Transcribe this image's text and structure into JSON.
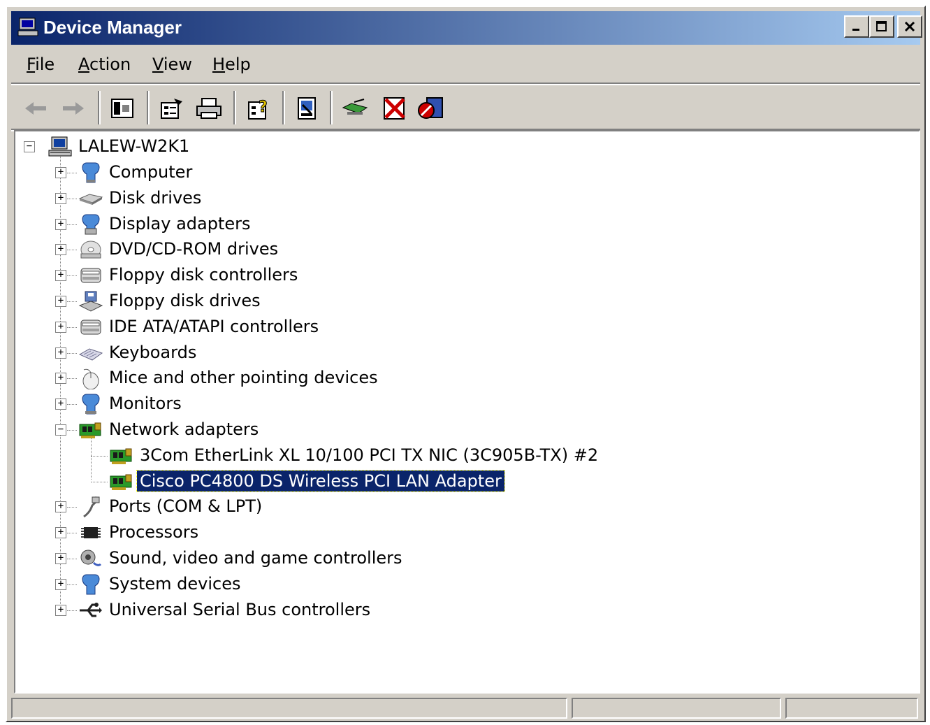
{
  "window": {
    "title": "Device Manager",
    "icon": "computer-icon",
    "controls": [
      "_",
      "□",
      "✕"
    ]
  },
  "menu": [
    {
      "label_first": "F",
      "label_rest": "ile"
    },
    {
      "label_first": "A",
      "label_rest": "ction"
    },
    {
      "label_first": "V",
      "label_rest": "iew"
    },
    {
      "label_first": "H",
      "label_rest": "elp"
    }
  ],
  "toolbar": [
    "back-icon",
    "forward-icon",
    "show-hide-tree-icon",
    "properties-icon",
    "print-icon",
    "help-icon",
    "scan-hardware-icon",
    "update-driver-icon",
    "uninstall-icon",
    "disable-icon"
  ],
  "tree": {
    "root": "LALEW-W2K1",
    "items": [
      {
        "label": "Computer",
        "icon": "computer-blue-icon",
        "expander": "+"
      },
      {
        "label": "Disk drives",
        "icon": "disk-drive-icon",
        "expander": "+"
      },
      {
        "label": "Display adapters",
        "icon": "display-adapter-icon",
        "expander": "+"
      },
      {
        "label": "DVD/CD-ROM drives",
        "icon": "cdrom-icon",
        "expander": "+"
      },
      {
        "label": "Floppy disk controllers",
        "icon": "controller-icon",
        "expander": "+"
      },
      {
        "label": "Floppy disk drives",
        "icon": "floppy-drive-icon",
        "expander": "+"
      },
      {
        "label": "IDE ATA/ATAPI controllers",
        "icon": "controller-icon",
        "expander": "+"
      },
      {
        "label": "Keyboards",
        "icon": "keyboard-icon",
        "expander": "+"
      },
      {
        "label": "Mice and other pointing devices",
        "icon": "mouse-icon",
        "expander": "+"
      },
      {
        "label": "Monitors",
        "icon": "monitor-icon",
        "expander": "+"
      },
      {
        "label": "Network adapters",
        "icon": "network-card-icon",
        "expander": "−"
      },
      {
        "label": "Ports (COM & LPT)",
        "icon": "port-icon",
        "expander": "+"
      },
      {
        "label": "Processors",
        "icon": "processor-icon",
        "expander": "+"
      },
      {
        "label": "Sound, video and game controllers",
        "icon": "sound-icon",
        "expander": "+"
      },
      {
        "label": "System devices",
        "icon": "system-icon",
        "expander": "+"
      },
      {
        "label": "Universal Serial Bus controllers",
        "icon": "usb-icon",
        "expander": "+"
      }
    ],
    "network_children": [
      {
        "label": "3Com EtherLink XL 10/100 PCI TX NIC (3C905B-TX) #2",
        "selected": false
      },
      {
        "label": "Cisco PC4800 DS Wireless PCI LAN Adapter",
        "selected": true
      }
    ]
  },
  "colors": {
    "titlebar_start": "#0a246a",
    "titlebar_end": "#a6caf0",
    "selection": "#0a246a",
    "face": "#d4d0c8"
  }
}
